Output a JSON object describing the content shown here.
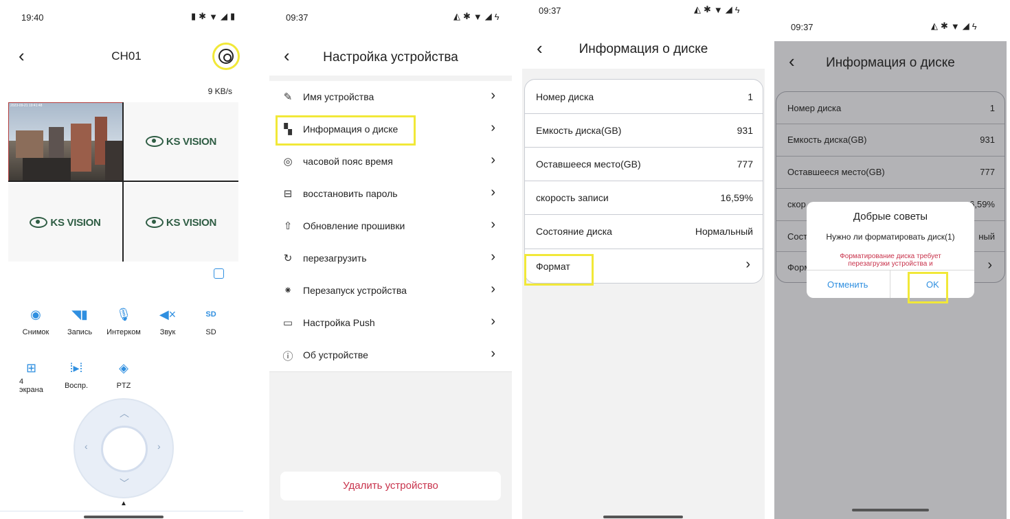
{
  "screen1": {
    "status_time": "19:40",
    "title": "CH01",
    "bitrate": "9 KB/s",
    "cam_timestamp": "2023-09-21 19:41:48",
    "logo_text": "KS VISION",
    "toolbar": [
      {
        "label": "Снимок",
        "icon": "camera-icon"
      },
      {
        "label": "Запись",
        "icon": "record-icon"
      },
      {
        "label": "Интерком",
        "icon": "microphone-icon"
      },
      {
        "label": "Звук",
        "icon": "speaker-mute-icon"
      },
      {
        "label": "SD",
        "icon": "sd-card-icon"
      }
    ],
    "toolbar2": [
      {
        "label": "4 экрана",
        "icon": "grid-icon"
      },
      {
        "label": "Воспр.",
        "icon": "playback-icon"
      },
      {
        "label": "PTZ",
        "icon": "ptz-icon"
      }
    ],
    "sd_badge": "SD"
  },
  "screen2": {
    "status_time": "09:37",
    "title": "Настройка устройства",
    "items": [
      {
        "label": "Имя устройства"
      },
      {
        "label": "Информация о диске"
      },
      {
        "label": "часовой пояс время"
      },
      {
        "label": "восстановить пароль"
      },
      {
        "label": "Обновление прошивки"
      },
      {
        "label": "перезагрузить"
      },
      {
        "label": "Перезапуск устройства"
      },
      {
        "label": "Настройка Push"
      },
      {
        "label": "Об устройстве"
      }
    ],
    "delete_label": "Удалить устройство"
  },
  "screen3": {
    "status_time": "09:37",
    "title": "Информация о диске",
    "rows": [
      {
        "key": "Номер диска",
        "value": "1"
      },
      {
        "key": "Емкость диска(GB)",
        "value": "931"
      },
      {
        "key": "Оставшееся место(GB)",
        "value": "777"
      },
      {
        "key": "скорость записи",
        "value": "16,59%"
      },
      {
        "key": "Состояние диска",
        "value": "Нормальный"
      }
    ],
    "format_label": "Формат"
  },
  "screen4": {
    "status_time": "09:37",
    "title": "Информация о диске",
    "rows": [
      {
        "key": "Номер диска",
        "value": "1"
      },
      {
        "key": "Емкость диска(GB)",
        "value": "931"
      },
      {
        "key": "Оставшееся место(GB)",
        "value": "777"
      },
      {
        "key": "скор",
        "value": "6,59%"
      },
      {
        "key": "Состо",
        "value": "ный"
      }
    ],
    "format_label": "Форм",
    "dialog": {
      "title": "Добрые советы",
      "message": "Нужно ли форматировать диск(1)",
      "warning": "Форматирование диска требует перезагрузки устройства и",
      "cancel": "Отменить",
      "ok": "OK"
    }
  },
  "colors": {
    "accent": "#2f8fe0",
    "danger": "#c8324b",
    "highlight": "#f1e838",
    "overlay": "#b3b3b6"
  }
}
